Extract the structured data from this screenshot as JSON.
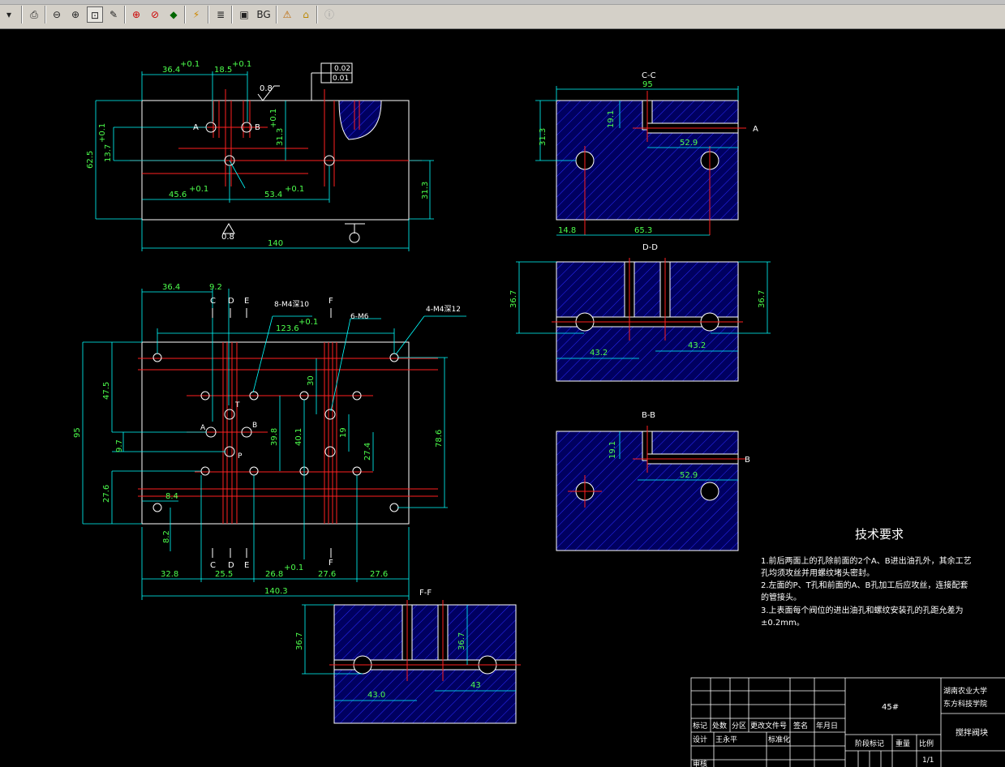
{
  "toolbar": {
    "bg_label": "BG",
    "buttons": [
      "file-menu-icon",
      "print-icon",
      "zoom-out-icon",
      "zoom-in-icon",
      "zoom-window-icon",
      "zoom-dynamic-icon",
      "zoom-extents-icon",
      "zoom-previous-icon",
      "pan-icon",
      "layer-toggle-icon",
      "layers-icon",
      "frame-icon",
      "bg-button",
      "settings-icon",
      "home-icon",
      "info-icon"
    ]
  },
  "front_view": {
    "dims": [
      "36.4",
      "+0.1",
      "18.5",
      "+0.1",
      "0.8",
      "62.5",
      "13.7",
      "+0.1",
      "31.3",
      "+0.1",
      "45.6",
      "+0.1",
      "53.4",
      "+0.1",
      "31.3",
      "140",
      "0.8"
    ],
    "labels": {
      "a": "A",
      "b": "B",
      "gdt_top": "0.02",
      "gdt_bot": "0.01"
    }
  },
  "top_view": {
    "dims": [
      "36.4",
      "9.2",
      "123.6",
      "+0.1",
      "47.5",
      "9.7",
      "95",
      "27.6",
      "8.4",
      "8.2",
      "39.8",
      "40.1",
      "30",
      "19",
      "27.4",
      "78.6",
      "32.8",
      "25.5",
      "26.8",
      "+0.1",
      "27.6",
      "27.6",
      "140.3"
    ],
    "section_marks": [
      "C",
      "D",
      "E",
      "F",
      "C",
      "D",
      "E",
      "F"
    ],
    "callouts": [
      "8-M4深10",
      "6-M6",
      "4-M4深12"
    ],
    "letters": [
      "A",
      "B",
      "T",
      "P"
    ]
  },
  "section_cc": {
    "title": "C-C",
    "dims": [
      "95",
      "19.1",
      "31.3",
      "52.9",
      "14.8",
      "65.3"
    ],
    "label": "A"
  },
  "section_dd": {
    "title": "D-D",
    "dims": [
      "36.7",
      "36.7",
      "43.2",
      "43.2"
    ]
  },
  "section_bb": {
    "title": "B-B",
    "dims": [
      "19.1",
      "52.9"
    ],
    "label": "B"
  },
  "section_ff": {
    "title": "F-F",
    "dims": [
      "36.7",
      "36.7",
      "43.0",
      "43"
    ]
  },
  "tech_req": {
    "title": "技术要求",
    "lines": [
      "1.前后两面上的孔除前面的2个A、B进出油孔外，其余工艺",
      "孔均须攻丝并用螺纹堵头密封。",
      "2.左面的P、T孔和前面的A、B孔加工后应攻丝，连接配套",
      "的管接头。",
      "3.上表面每个阀位的进出油孔和螺纹安装孔的孔距允差为",
      "±0.2mm。"
    ]
  },
  "title_block": {
    "material": "45#",
    "school1": "湖南农业大学",
    "school2": "东方科技学院",
    "part_name": "搅拌阀块",
    "row1": [
      "标记",
      "处数",
      "分区",
      "更改文件号",
      "签名",
      "年月日"
    ],
    "row2": [
      "设计",
      "王永平",
      "标准化"
    ],
    "row3": [
      "审核"
    ],
    "stage_labels": [
      "阶段标记",
      "重量",
      "比例"
    ],
    "scale": "1/1"
  },
  "colors": {
    "background": "#000000",
    "outline": "#ffffff",
    "dimension": "#00ffff",
    "dimtext": "#4dff4d",
    "centerline": "#ff2020",
    "hatch": "#2a2aff",
    "hatch_fill": "#000060"
  }
}
